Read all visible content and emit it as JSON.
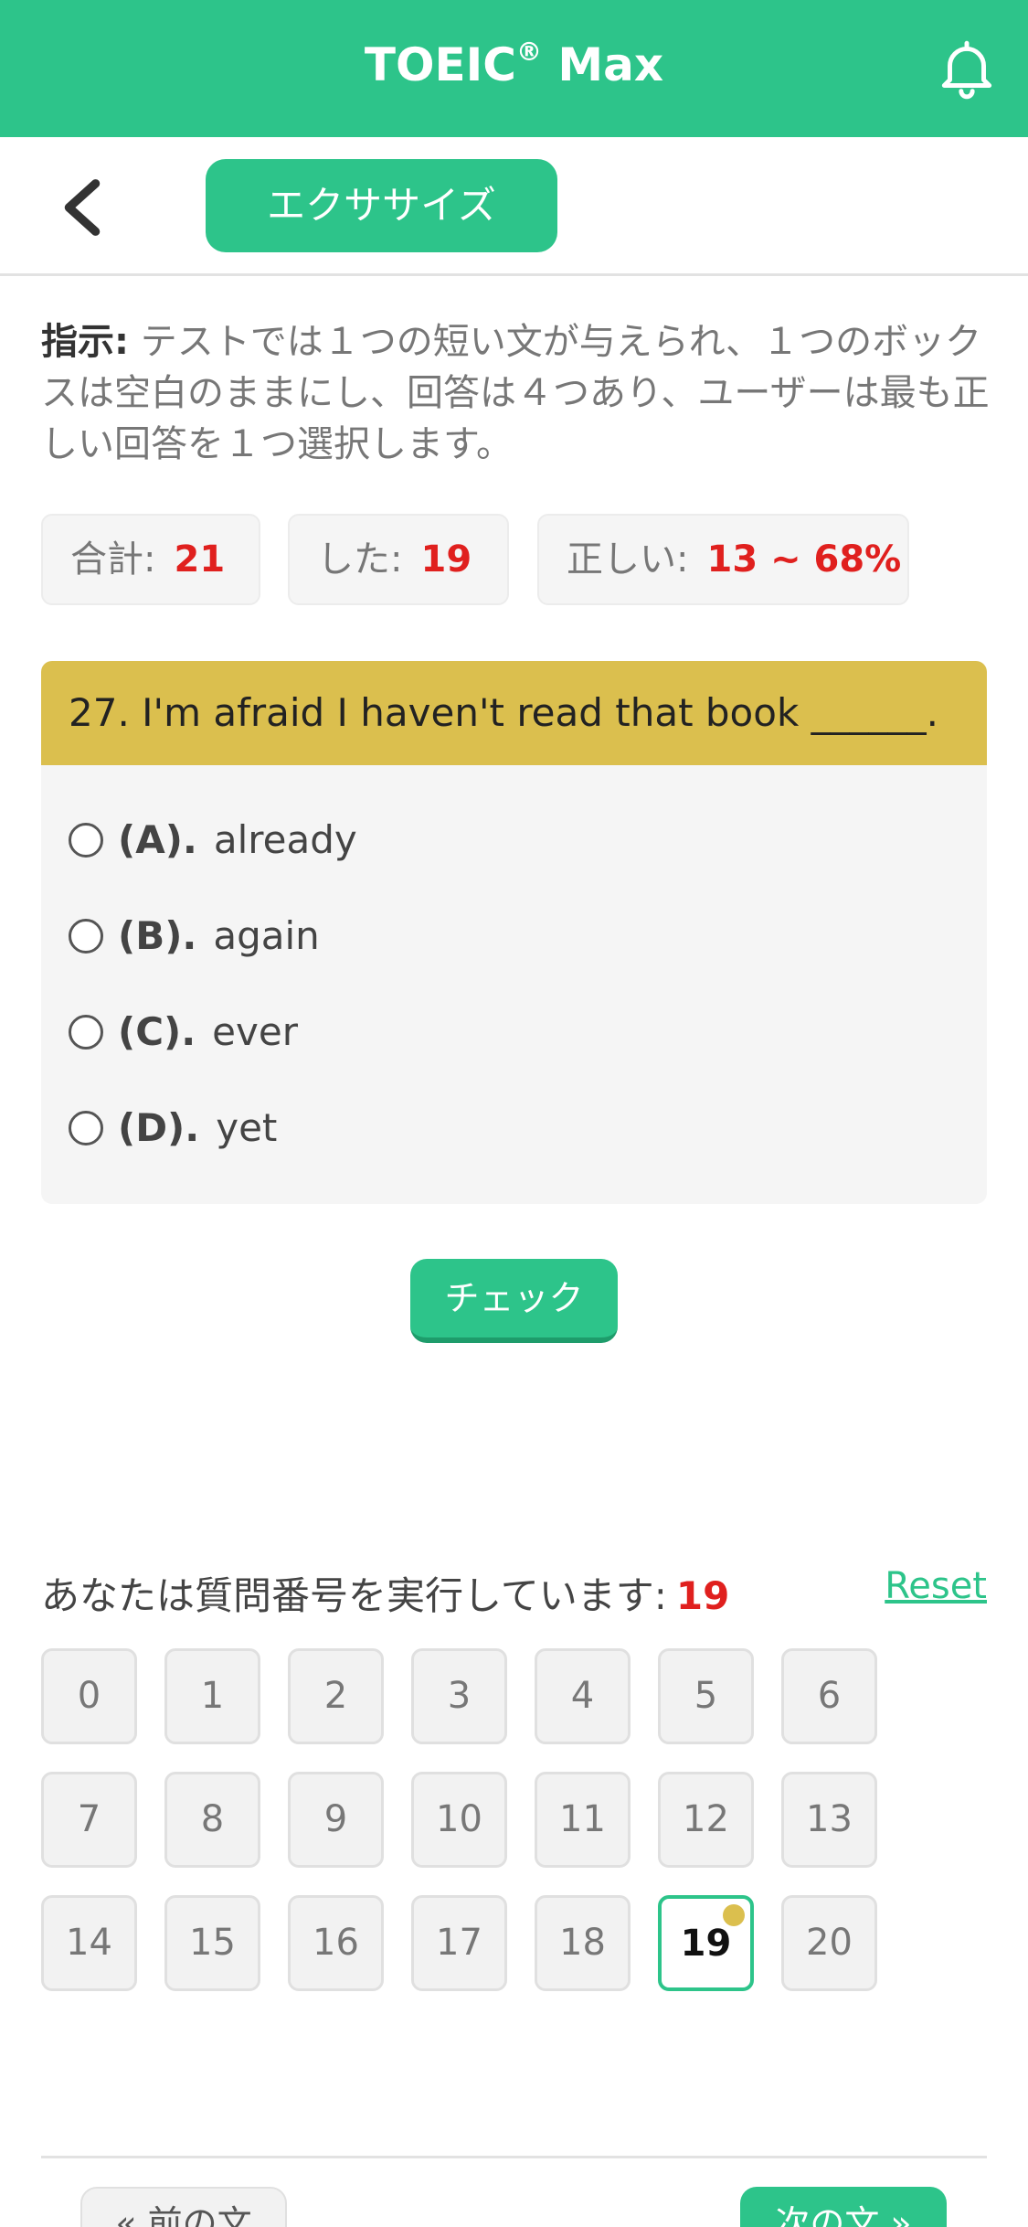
{
  "header": {
    "title": "TOEIC",
    "title_mark": "®",
    "title_suffix": " Max",
    "bell_icon": "bell-icon"
  },
  "nav": {
    "back_icon": "chevron-left-icon",
    "tab_label": "エクササイズ"
  },
  "instructions": {
    "label": "指示:",
    "text": " テストでは１つの短い文が与えられ、１つのボックスは空白のままにし、回答は４つあり、ユーザーは最も正しい回答を１つ選択します。"
  },
  "stats": {
    "total_label": "合計:",
    "total_value": "21",
    "done_label": "した:",
    "done_value": "19",
    "correct_label": "正しい:",
    "correct_value": "13 ~ 68%"
  },
  "question": {
    "text": "27. I'm afraid I haven't read that book ______.",
    "options": [
      {
        "letter": "(A).",
        "text": "already"
      },
      {
        "letter": "(B).",
        "text": "again"
      },
      {
        "letter": "(C).",
        "text": "ever"
      },
      {
        "letter": "(D).",
        "text": "yet"
      }
    ]
  },
  "check_label": "チェック",
  "progress": {
    "label": "あなたは質問番号を実行しています:",
    "current": "19",
    "reset_label": "Reset",
    "numbers": [
      "0",
      "1",
      "2",
      "3",
      "4",
      "5",
      "6",
      "7",
      "8",
      "9",
      "10",
      "11",
      "12",
      "13",
      "14",
      "15",
      "16",
      "17",
      "18",
      "19",
      "20"
    ]
  },
  "footer": {
    "prev_label": "« 前の文",
    "next_label": "次の文 »"
  },
  "colors": {
    "brand": "#2dc48a",
    "question_header": "#dbbf4e",
    "accent_red": "#e0201e"
  }
}
